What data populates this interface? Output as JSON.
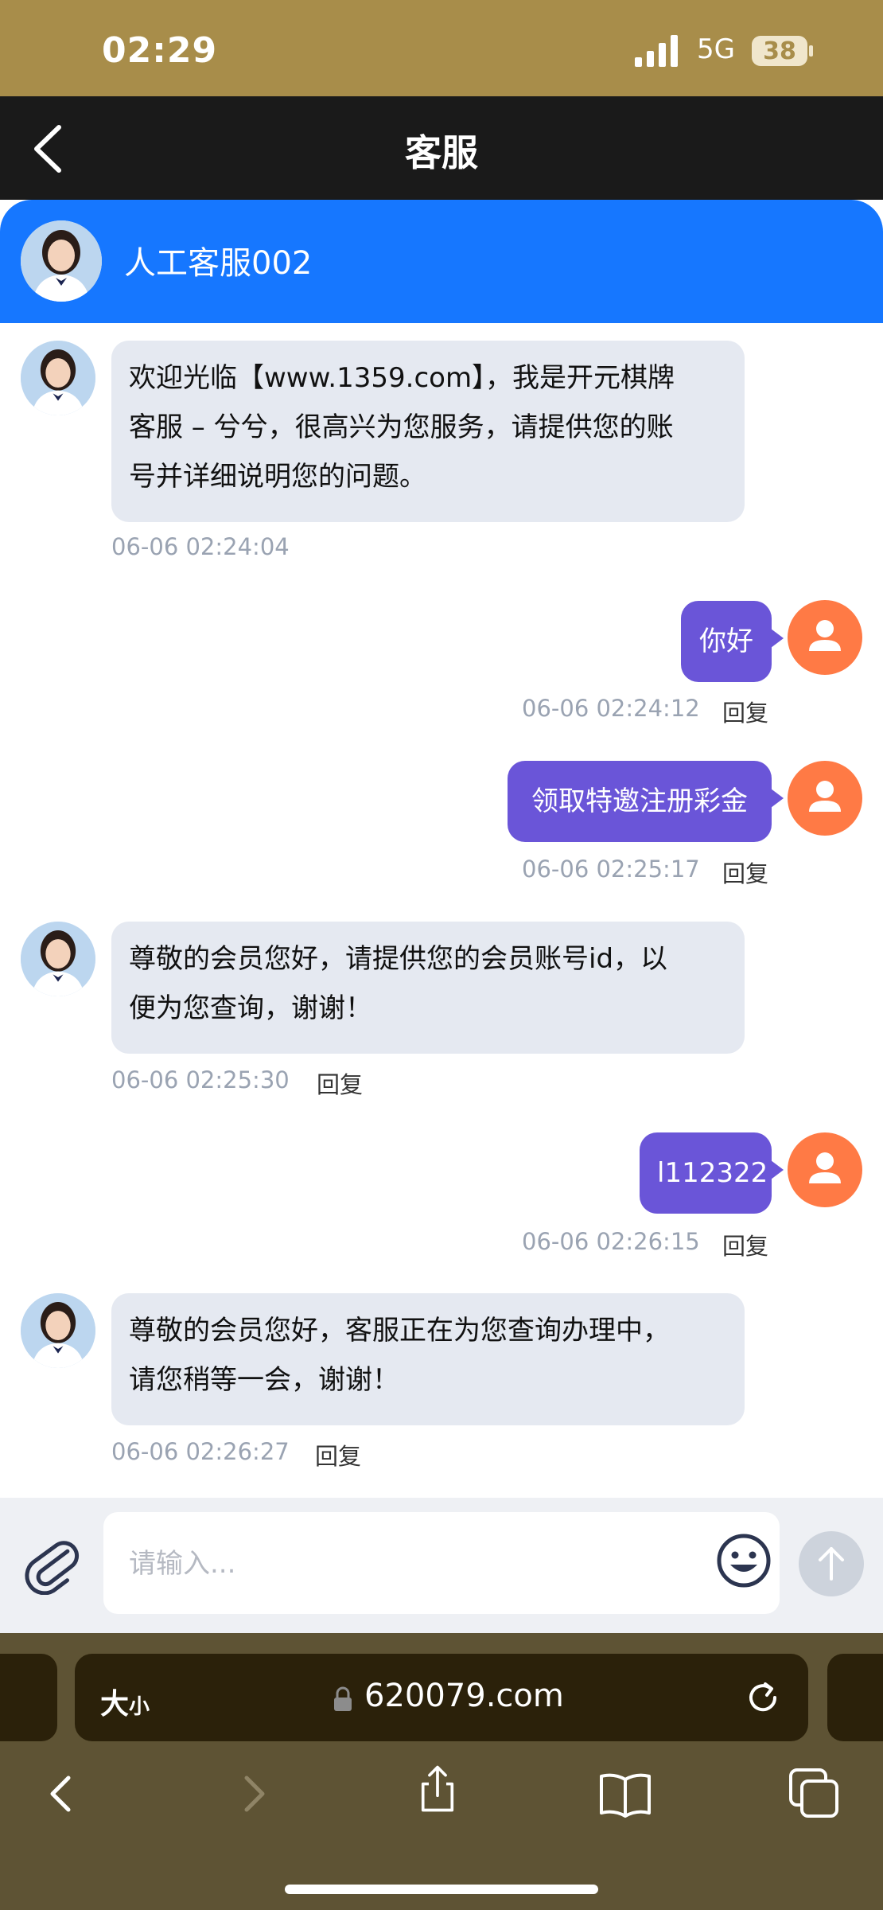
{
  "status_bar": {
    "time": "02:29",
    "network": "5G",
    "battery": "38"
  },
  "header": {
    "title": "客服",
    "back_icon": "chevron-left-icon"
  },
  "agent": {
    "name": "人工客服002"
  },
  "messages": [
    {
      "side": "agent",
      "lines": [
        "欢迎光临【www.1359.com】，我是开元棋牌",
        "客服 – 兮兮，很高兴为您服务，请提供您的账",
        "号并详细说明您的问题。"
      ],
      "time": "06-06 02:24:04"
    },
    {
      "side": "user",
      "text": "你好",
      "time": "06-06 02:24:12",
      "reply": "回复"
    },
    {
      "side": "user",
      "text": "领取特邀注册彩金",
      "time": "06-06 02:25:17",
      "reply": "回复"
    },
    {
      "side": "agent",
      "lines": [
        "尊敬的会员您好，请提供您的会员账号id，以",
        "便为您查询，谢谢！"
      ],
      "time": "06-06 02:25:30",
      "reply": "回复"
    },
    {
      "side": "user",
      "text": "l112322",
      "time": "06-06 02:26:15",
      "reply": "回复"
    },
    {
      "side": "agent",
      "lines": [
        "尊敬的会员您好，客服正在为您查询办理中，",
        "请您稍等一会，谢谢！"
      ],
      "time": "06-06 02:26:27",
      "reply": "回复"
    }
  ],
  "composer": {
    "placeholder": "请输入...",
    "attach_icon": "paperclip-icon",
    "emoji_icon": "smiley-icon",
    "send_icon": "arrow-up-icon"
  },
  "browser": {
    "text_size_label": "大",
    "text_size_small": "小",
    "url": "620079.com",
    "nav_icons": [
      "back-icon",
      "forward-icon",
      "share-icon",
      "bookmarks-icon",
      "tabs-icon"
    ]
  },
  "colors": {
    "status_bar": "#a88d4a",
    "header": "#1a1a1a",
    "agent_bar": "#1677ff",
    "user_bubble": "#6a55d8",
    "agent_bubble": "#e5e9f1",
    "user_avatar": "#ff7a45"
  }
}
